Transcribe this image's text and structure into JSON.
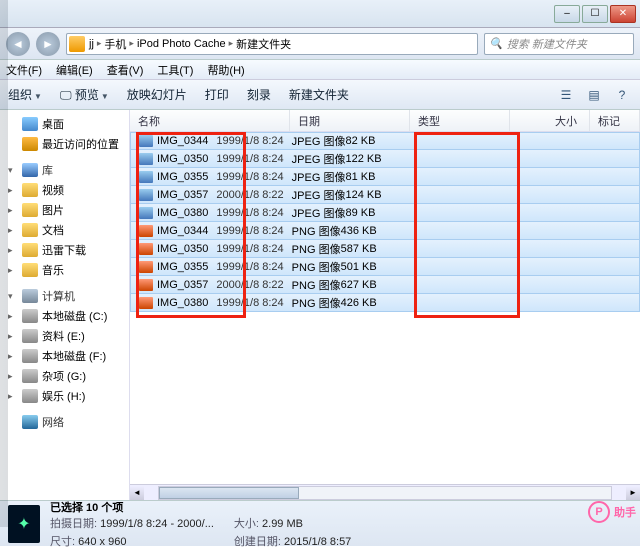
{
  "window": {
    "min": "–",
    "max": "☐",
    "close": "✕"
  },
  "breadcrumbs": [
    "jj",
    "手机",
    "iPod Photo Cache",
    "新建文件夹"
  ],
  "search_placeholder": "搜索 新建文件夹",
  "menu": {
    "file": "文件(F)",
    "edit": "编辑(E)",
    "view": "查看(V)",
    "tools": "工具(T)",
    "help": "帮助(H)"
  },
  "toolbar": {
    "organize": "组织",
    "preview": "预览",
    "slideshow": "放映幻灯片",
    "print": "打印",
    "burn": "刻录",
    "newfolder": "新建文件夹"
  },
  "tree": {
    "desktop": "桌面",
    "recent": "最近访问的位置",
    "libraries": "库",
    "videos": "视频",
    "pictures": "图片",
    "documents": "文档",
    "thunder": "迅雷下载",
    "music": "音乐",
    "computer": "计算机",
    "driveC": "本地磁盘 (C:)",
    "driveE": "资料 (E:)",
    "driveF": "本地磁盘 (F:)",
    "driveG": "杂项 (G:)",
    "driveH": "娱乐 (H:)",
    "network": "网络"
  },
  "columns": {
    "name": "名称",
    "date": "日期",
    "type": "类型",
    "size": "大小",
    "tags": "标记"
  },
  "type_labels": {
    "jpeg": "JPEG 图像",
    "png": "PNG 图像"
  },
  "files": [
    {
      "name": "IMG_0344",
      "date": "1999/1/8 8:24",
      "type": "jpeg",
      "size": "82 KB"
    },
    {
      "name": "IMG_0350",
      "date": "1999/1/8 8:24",
      "type": "jpeg",
      "size": "122 KB"
    },
    {
      "name": "IMG_0355",
      "date": "1999/1/8 8:24",
      "type": "jpeg",
      "size": "81 KB"
    },
    {
      "name": "IMG_0357",
      "date": "2000/1/8 8:22",
      "type": "jpeg",
      "size": "124 KB"
    },
    {
      "name": "IMG_0380",
      "date": "1999/1/8 8:24",
      "type": "jpeg",
      "size": "89 KB"
    },
    {
      "name": "IMG_0344",
      "date": "1999/1/8 8:24",
      "type": "png",
      "size": "436 KB"
    },
    {
      "name": "IMG_0350",
      "date": "1999/1/8 8:24",
      "type": "png",
      "size": "587 KB"
    },
    {
      "name": "IMG_0355",
      "date": "1999/1/8 8:24",
      "type": "png",
      "size": "501 KB"
    },
    {
      "name": "IMG_0357",
      "date": "2000/1/8 8:22",
      "type": "png",
      "size": "627 KB"
    },
    {
      "name": "IMG_0380",
      "date": "1999/1/8 8:24",
      "type": "png",
      "size": "426 KB"
    }
  ],
  "details": {
    "selection": "已选择 10 个项",
    "shot_k": "拍摄日期:",
    "shot_v": "1999/1/8 8:24 - 2000/...",
    "dim_k": "尺寸:",
    "dim_v": "640 x 960",
    "size_k": "大小:",
    "size_v": "2.99 MB",
    "created_k": "创建日期:",
    "created_v": "2015/1/8 8:57"
  },
  "watermark": "助手"
}
